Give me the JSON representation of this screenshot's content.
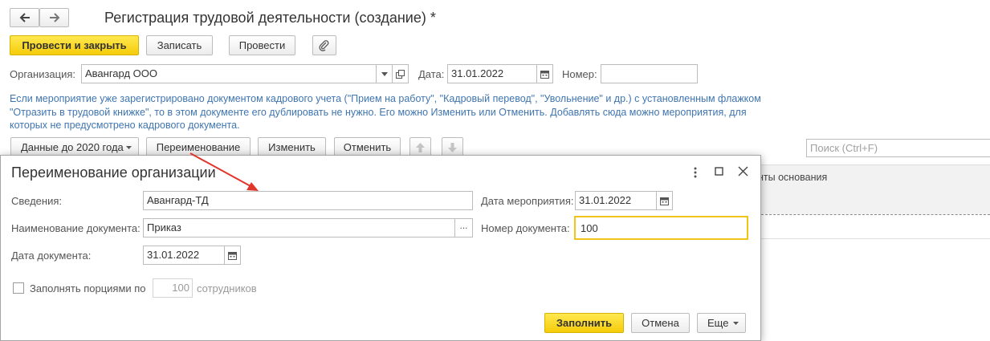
{
  "window": {
    "title": "Регистрация трудовой деятельности (создание) *"
  },
  "nav": {
    "back_icon": "arrow-left-icon",
    "forward_icon": "arrow-right-icon"
  },
  "toolbar": {
    "post_close_label": "Провести и закрыть",
    "save_label": "Записать",
    "post_label": "Провести",
    "attach_icon": "paperclip-icon"
  },
  "header_fields": {
    "org_label": "Организация:",
    "org_value": "Авангард ООО",
    "date_label": "Дата:",
    "date_value": "31.01.2022",
    "number_label": "Номер:",
    "number_value": ""
  },
  "info_text": "Если мероприятие уже зарегистрировано документом кадрового учета (\"Прием на работу\", \"Кадровый перевод\", \"Увольнение\" и др.) с установленным флажком \"Отразить в трудовой книжке\", то в этом документе его дублировать не нужно. Его можно Изменить или Отменить. Добавлять сюда можно мероприятия, для которых не предусмотрено кадрового документа.",
  "list_toolbar": {
    "data_before_label": "Данные до 2020 года",
    "rename_label": "Переименование",
    "change_label": "Изменить",
    "cancel_label": "Отменить",
    "search_placeholder": "Поиск (Ctrl+F)"
  },
  "table": {
    "column_header_partial": "нты основания"
  },
  "dialog": {
    "title": "Переименование организации",
    "info_label": "Сведения:",
    "info_value": "Авангард-ТД",
    "event_date_label": "Дата мероприятия:",
    "event_date_value": "31.01.2022",
    "doc_name_label": "Наименование документа:",
    "doc_name_value": "Приказ",
    "doc_number_label": "Номер документа:",
    "doc_number_value": "100",
    "doc_date_label": "Дата документа:",
    "doc_date_value": "31.01.2022",
    "batch_label": "Заполнять порциями по",
    "batch_checked": false,
    "batch_value": "100",
    "batch_suffix": "сотрудников",
    "fill_label": "Заполнить",
    "cancel_label": "Отмена",
    "more_label": "Еще"
  },
  "colors": {
    "accent_yellow": "#f5cc0a",
    "info_blue": "#3f75b0",
    "annotation_red": "#e0352b",
    "focus_border": "#f0c419"
  }
}
